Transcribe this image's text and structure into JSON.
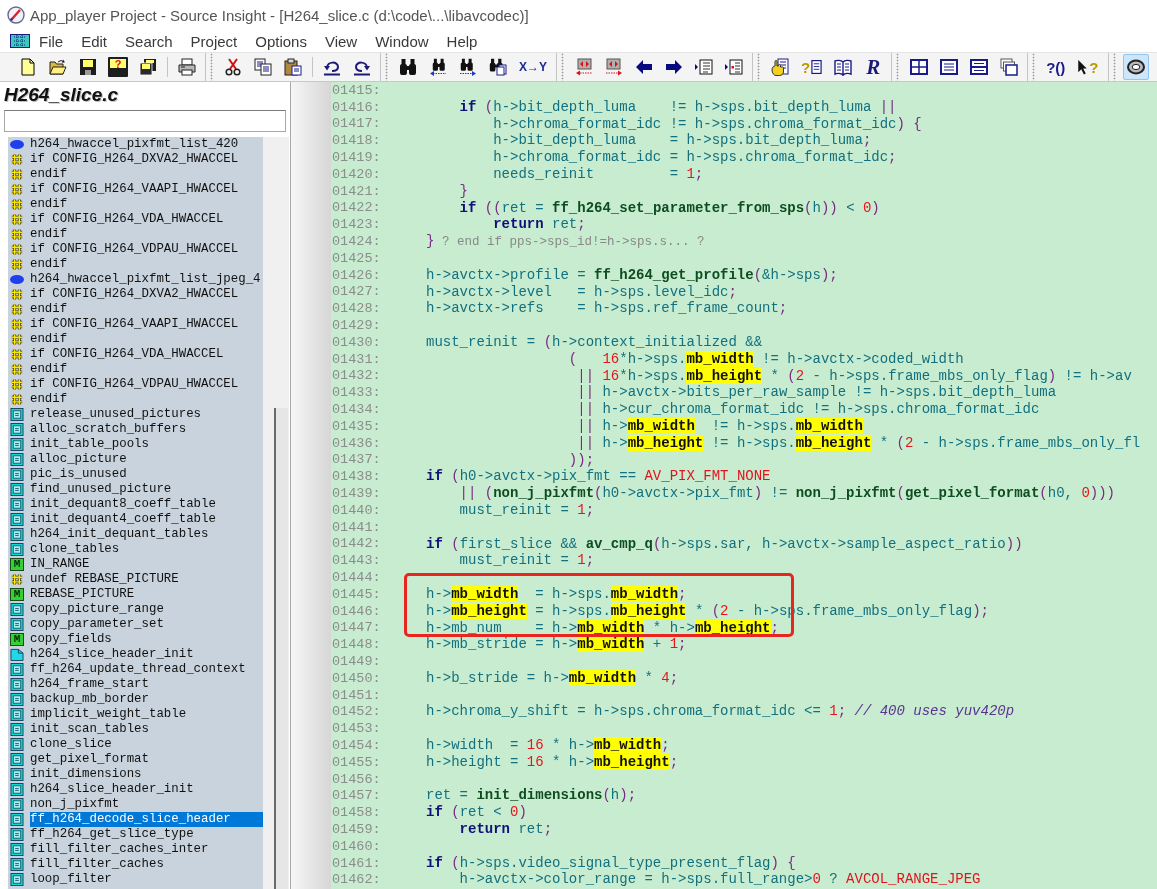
{
  "window": {
    "title": "App_player Project - Source Insight - [H264_slice.c (d:\\code\\...\\libavcodec)]"
  },
  "menu": {
    "items": [
      "File",
      "Edit",
      "Search",
      "Project",
      "Options",
      "View",
      "Window",
      "Help"
    ]
  },
  "toolbar": {
    "bands": [
      {
        "groups": [
          {
            "buttons": [
              {
                "kind": "new",
                "pressed": false
              },
              {
                "kind": "open",
                "pressed": false
              },
              {
                "kind": "save",
                "pressed": false
              },
              {
                "kind": "save_query",
                "label": "?",
                "pressed": false
              },
              {
                "kind": "save_all",
                "pressed": false
              }
            ]
          },
          {
            "buttons": [
              {
                "kind": "print",
                "pressed": false
              }
            ]
          }
        ]
      },
      {
        "groups": [
          {
            "buttons": [
              {
                "kind": "cut",
                "pressed": false
              },
              {
                "kind": "copy",
                "pressed": false
              },
              {
                "kind": "paste",
                "pressed": false
              }
            ]
          },
          {
            "buttons": [
              {
                "kind": "undo",
                "pressed": false
              },
              {
                "kind": "redo",
                "pressed": false
              }
            ]
          }
        ]
      },
      {
        "groups": [
          {
            "buttons": [
              {
                "kind": "find",
                "pressed": false
              },
              {
                "kind": "find_back",
                "pressed": false
              },
              {
                "kind": "find_forward",
                "pressed": false
              },
              {
                "kind": "find_files",
                "pressed": false
              },
              {
                "kind": "replace",
                "label": "X→Y",
                "pressed": false
              }
            ]
          }
        ]
      },
      {
        "groups": [
          {
            "buttons": [
              {
                "kind": "jump_back",
                "pressed": false
              },
              {
                "kind": "jump_forward",
                "pressed": false
              },
              {
                "kind": "back",
                "pressed": false
              },
              {
                "kind": "forward",
                "pressed": false
              },
              {
                "kind": "outline",
                "pressed": false
              },
              {
                "kind": "outline_mark",
                "pressed": false
              }
            ]
          }
        ]
      },
      {
        "groups": [
          {
            "buttons": [
              {
                "kind": "lookup",
                "pressed": false
              },
              {
                "kind": "help_doc",
                "label": "?",
                "pressed": false
              },
              {
                "kind": "book",
                "pressed": false
              },
              {
                "kind": "r_logo",
                "label": "R",
                "pressed": false
              }
            ]
          }
        ]
      },
      {
        "groups": [
          {
            "buttons": [
              {
                "kind": "layout_grid",
                "pressed": false
              },
              {
                "kind": "layout_rows",
                "pressed": false
              },
              {
                "kind": "layout_split",
                "pressed": false
              },
              {
                "kind": "layout_cascade",
                "pressed": false
              }
            ]
          }
        ]
      },
      {
        "groups": [
          {
            "buttons": [
              {
                "kind": "help_paren",
                "label": "?()",
                "pressed": false
              },
              {
                "kind": "help_pointer",
                "label": "?",
                "pressed": false
              }
            ]
          }
        ]
      },
      {
        "groups": [
          {
            "buttons": [
              {
                "kind": "lens",
                "pressed": true
              }
            ]
          }
        ]
      }
    ]
  },
  "sidebar": {
    "title": "H264_slice.c",
    "items": [
      {
        "label": "h264_hwaccel_pixfmt_list_420",
        "kind": "variable",
        "selected": false
      },
      {
        "label": "if CONFIG_H264_DXVA2_HWACCEL",
        "kind": "conditional",
        "selected": false
      },
      {
        "label": "endif",
        "kind": "conditional",
        "selected": false
      },
      {
        "label": "if CONFIG_H264_VAAPI_HWACCEL",
        "kind": "conditional",
        "selected": false
      },
      {
        "label": "endif",
        "kind": "conditional",
        "selected": false
      },
      {
        "label": "if CONFIG_H264_VDA_HWACCEL",
        "kind": "conditional",
        "selected": false
      },
      {
        "label": "endif",
        "kind": "conditional",
        "selected": false
      },
      {
        "label": "if CONFIG_H264_VDPAU_HWACCEL",
        "kind": "conditional",
        "selected": false
      },
      {
        "label": "endif",
        "kind": "conditional",
        "selected": false
      },
      {
        "label": "h264_hwaccel_pixfmt_list_jpeg_4",
        "kind": "variable",
        "selected": false
      },
      {
        "label": "if CONFIG_H264_DXVA2_HWACCEL",
        "kind": "conditional",
        "selected": false
      },
      {
        "label": "endif",
        "kind": "conditional",
        "selected": false
      },
      {
        "label": "if CONFIG_H264_VAAPI_HWACCEL",
        "kind": "conditional",
        "selected": false
      },
      {
        "label": "endif",
        "kind": "conditional",
        "selected": false
      },
      {
        "label": "if CONFIG_H264_VDA_HWACCEL",
        "kind": "conditional",
        "selected": false
      },
      {
        "label": "endif",
        "kind": "conditional",
        "selected": false
      },
      {
        "label": "if CONFIG_H264_VDPAU_HWACCEL",
        "kind": "conditional",
        "selected": false
      },
      {
        "label": "endif",
        "kind": "conditional",
        "selected": false
      },
      {
        "label": "release_unused_pictures",
        "kind": "function",
        "selected": false
      },
      {
        "label": "alloc_scratch_buffers",
        "kind": "function",
        "selected": false
      },
      {
        "label": "init_table_pools",
        "kind": "function",
        "selected": false
      },
      {
        "label": "alloc_picture",
        "kind": "function",
        "selected": false
      },
      {
        "label": "pic_is_unused",
        "kind": "function",
        "selected": false
      },
      {
        "label": "find_unused_picture",
        "kind": "function",
        "selected": false
      },
      {
        "label": "init_dequant8_coeff_table",
        "kind": "function",
        "selected": false
      },
      {
        "label": "init_dequant4_coeff_table",
        "kind": "function",
        "selected": false
      },
      {
        "label": "h264_init_dequant_tables",
        "kind": "function",
        "selected": false
      },
      {
        "label": "clone_tables",
        "kind": "function",
        "selected": false
      },
      {
        "label": "IN_RANGE",
        "kind": "macro",
        "badge": "M",
        "selected": false
      },
      {
        "label": "undef REBASE_PICTURE",
        "kind": "conditional",
        "selected": false
      },
      {
        "label": "REBASE_PICTURE",
        "kind": "macro",
        "badge": "M",
        "selected": false
      },
      {
        "label": "copy_picture_range",
        "kind": "function",
        "selected": false
      },
      {
        "label": "copy_parameter_set",
        "kind": "function",
        "selected": false
      },
      {
        "label": "copy_fields",
        "kind": "macro",
        "badge": "M",
        "selected": false
      },
      {
        "label": "h264_slice_header_init",
        "kind": "prototype",
        "selected": false
      },
      {
        "label": "ff_h264_update_thread_context",
        "kind": "function",
        "selected": false
      },
      {
        "label": "h264_frame_start",
        "kind": "function",
        "selected": false
      },
      {
        "label": "backup_mb_border",
        "kind": "function",
        "selected": false
      },
      {
        "label": "implicit_weight_table",
        "kind": "function",
        "selected": false
      },
      {
        "label": "init_scan_tables",
        "kind": "function",
        "selected": false
      },
      {
        "label": "clone_slice",
        "kind": "function",
        "selected": false
      },
      {
        "label": "get_pixel_format",
        "kind": "function",
        "selected": false
      },
      {
        "label": "init_dimensions",
        "kind": "function",
        "selected": false
      },
      {
        "label": "h264_slice_header_init",
        "kind": "function",
        "selected": false
      },
      {
        "label": "non_j_pixfmt",
        "kind": "function",
        "selected": false
      },
      {
        "label": "ff_h264_decode_slice_header",
        "kind": "function",
        "selected": true
      },
      {
        "label": "ff_h264_get_slice_type",
        "kind": "function",
        "selected": false
      },
      {
        "label": "fill_filter_caches_inter",
        "kind": "function",
        "selected": false
      },
      {
        "label": "fill_filter_caches",
        "kind": "function",
        "selected": false
      },
      {
        "label": "loop_filter",
        "kind": "function",
        "selected": false
      }
    ]
  },
  "code": {
    "lines": [
      {
        "number": "01415:",
        "boxed": false
      },
      {
        "number": "01416:",
        "boxed": false,
        "tokens": [
          {
            "text": "        if",
            "kind": "keyword"
          },
          {
            "text": " (",
            "kind": "punct"
          },
          {
            "text": "h->bit_depth_luma    != h->sps.bit_depth_luma ",
            "kind": "ident"
          },
          {
            "text": "||",
            "kind": "punct"
          }
        ]
      },
      {
        "number": "01417:",
        "boxed": false,
        "tokens": [
          {
            "text": "            h->chroma_format_idc != h->sps.chroma_format_idc",
            "kind": "ident"
          },
          {
            "text": ") {",
            "kind": "punct"
          }
        ]
      },
      {
        "number": "01418:",
        "boxed": false,
        "tokens": [
          {
            "text": "            h->bit_depth_luma    = h->sps.bit_depth_luma",
            "kind": "ident"
          },
          {
            "text": ";",
            "kind": "punct"
          }
        ]
      },
      {
        "number": "01419:",
        "boxed": false,
        "tokens": [
          {
            "text": "            h->chroma_format_idc = h->sps.chroma_format_idc",
            "kind": "ident"
          },
          {
            "text": ";",
            "kind": "punct"
          }
        ]
      },
      {
        "number": "01420:",
        "boxed": false,
        "tokens": [
          {
            "text": "            needs_reinit         = ",
            "kind": "ident"
          },
          {
            "text": "1",
            "kind": "number"
          },
          {
            "text": ";",
            "kind": "punct"
          }
        ]
      },
      {
        "number": "01421:",
        "boxed": false,
        "tokens": [
          {
            "text": "        }",
            "kind": "punct"
          }
        ]
      },
      {
        "number": "01422:",
        "boxed": false,
        "tokens": [
          {
            "text": "        if",
            "kind": "keyword"
          },
          {
            "text": " ((",
            "kind": "punct"
          },
          {
            "text": "ret = ",
            "kind": "ident"
          },
          {
            "text": "ff_h264_set_parameter_from_sps",
            "kind": "function"
          },
          {
            "text": "(",
            "kind": "punct"
          },
          {
            "text": "h",
            "kind": "ident"
          },
          {
            "text": "))",
            "kind": "punct"
          },
          {
            "text": " < ",
            "kind": "ident"
          },
          {
            "text": "0",
            "kind": "number"
          },
          {
            "text": ")",
            "kind": "punct"
          }
        ]
      },
      {
        "number": "01423:",
        "boxed": false,
        "tokens": [
          {
            "text": "            return",
            "kind": "keyword"
          },
          {
            "text": " ret",
            "kind": "ident"
          },
          {
            "text": ";",
            "kind": "punct"
          }
        ]
      },
      {
        "number": "01424:",
        "boxed": false,
        "tokens": [
          {
            "text": "    }",
            "kind": "punct"
          },
          {
            "text": " ? end if pps->sps_id!=h->sps.s... ?",
            "kind": "note"
          }
        ]
      },
      {
        "number": "01425:",
        "boxed": false
      },
      {
        "number": "01426:",
        "boxed": false,
        "tokens": [
          {
            "text": "    h->avctx->profile = ",
            "kind": "ident"
          },
          {
            "text": "ff_h264_get_profile",
            "kind": "function"
          },
          {
            "text": "(",
            "kind": "punct"
          },
          {
            "text": "&h->sps",
            "kind": "ident"
          },
          {
            "text": ");",
            "kind": "punct"
          }
        ]
      },
      {
        "number": "01427:",
        "boxed": false,
        "tokens": [
          {
            "text": "    h->avctx->level   = h->sps.level_idc",
            "kind": "ident"
          },
          {
            "text": ";",
            "kind": "punct"
          }
        ]
      },
      {
        "number": "01428:",
        "boxed": false,
        "tokens": [
          {
            "text": "    h->avctx->refs    = h->sps.ref_frame_count",
            "kind": "ident"
          },
          {
            "text": ";",
            "kind": "punct"
          }
        ]
      },
      {
        "number": "01429:",
        "boxed": false
      },
      {
        "number": "01430:",
        "boxed": false,
        "tokens": [
          {
            "text": "    must_reinit = ",
            "kind": "ident"
          },
          {
            "text": "(",
            "kind": "punct"
          },
          {
            "text": "h->context_initialized &&",
            "kind": "ident"
          }
        ]
      },
      {
        "number": "01431:",
        "boxed": false,
        "tokens": [
          {
            "text": "                     (   ",
            "kind": "punct"
          },
          {
            "text": "16",
            "kind": "number"
          },
          {
            "text": "*h->sps.",
            "kind": "ident"
          },
          {
            "text": "mb_width",
            "kind": "highlight"
          },
          {
            "text": " != h->avctx->coded_width",
            "kind": "ident"
          }
        ]
      },
      {
        "number": "01432:",
        "boxed": false,
        "tokens": [
          {
            "text": "                      || ",
            "kind": "punct"
          },
          {
            "text": "16",
            "kind": "number"
          },
          {
            "text": "*h->sps.",
            "kind": "ident"
          },
          {
            "text": "mb_height",
            "kind": "highlight"
          },
          {
            "text": " * ",
            "kind": "ident"
          },
          {
            "text": "(",
            "kind": "punct"
          },
          {
            "text": "2",
            "kind": "number"
          },
          {
            "text": " - h->sps.frame_mbs_only_flag",
            "kind": "ident"
          },
          {
            "text": ")",
            "kind": "punct"
          },
          {
            "text": " != h->av",
            "kind": "ident"
          }
        ]
      },
      {
        "number": "01433:",
        "boxed": false,
        "tokens": [
          {
            "text": "                      ||",
            "kind": "punct"
          },
          {
            "text": " h->avctx->bits_per_raw_sample != h->sps.bit_depth_luma",
            "kind": "ident"
          }
        ]
      },
      {
        "number": "01434:",
        "boxed": false,
        "tokens": [
          {
            "text": "                      ||",
            "kind": "punct"
          },
          {
            "text": " h->cur_chroma_format_idc != h->sps.chroma_format_idc",
            "kind": "ident"
          }
        ]
      },
      {
        "number": "01435:",
        "boxed": false,
        "tokens": [
          {
            "text": "                      ||",
            "kind": "punct"
          },
          {
            "text": " h->",
            "kind": "ident"
          },
          {
            "text": "mb_width",
            "kind": "highlight"
          },
          {
            "text": "  != h->sps.",
            "kind": "ident"
          },
          {
            "text": "mb_width",
            "kind": "highlight"
          }
        ]
      },
      {
        "number": "01436:",
        "boxed": false,
        "tokens": [
          {
            "text": "                      ||",
            "kind": "punct"
          },
          {
            "text": " h->",
            "kind": "ident"
          },
          {
            "text": "mb_height",
            "kind": "highlight"
          },
          {
            "text": " != h->sps.",
            "kind": "ident"
          },
          {
            "text": "mb_height",
            "kind": "highlight"
          },
          {
            "text": " * ",
            "kind": "ident"
          },
          {
            "text": "(",
            "kind": "punct"
          },
          {
            "text": "2",
            "kind": "number"
          },
          {
            "text": " - h->sps.frame_mbs_only_fl",
            "kind": "ident"
          }
        ]
      },
      {
        "number": "01437:",
        "boxed": false,
        "tokens": [
          {
            "text": "                     ));",
            "kind": "punct"
          }
        ]
      },
      {
        "number": "01438:",
        "boxed": false,
        "tokens": [
          {
            "text": "    if",
            "kind": "keyword"
          },
          {
            "text": " (",
            "kind": "punct"
          },
          {
            "text": "h0->avctx->pix_fmt == ",
            "kind": "ident"
          },
          {
            "text": "AV_PIX_FMT_NONE",
            "kind": "constant"
          }
        ]
      },
      {
        "number": "01439:",
        "boxed": false,
        "tokens": [
          {
            "text": "        || (",
            "kind": "punct"
          },
          {
            "text": "non_j_pixfmt",
            "kind": "function"
          },
          {
            "text": "(",
            "kind": "punct"
          },
          {
            "text": "h0->avctx->pix_fmt",
            "kind": "ident"
          },
          {
            "text": ")",
            "kind": "punct"
          },
          {
            "text": " != ",
            "kind": "ident"
          },
          {
            "text": "non_j_pixfmt",
            "kind": "function"
          },
          {
            "text": "(",
            "kind": "punct"
          },
          {
            "text": "get_pixel_format",
            "kind": "function"
          },
          {
            "text": "(",
            "kind": "punct"
          },
          {
            "text": "h0, ",
            "kind": "ident"
          },
          {
            "text": "0",
            "kind": "number"
          },
          {
            "text": ")))",
            "kind": "punct"
          }
        ]
      },
      {
        "number": "01440:",
        "boxed": false,
        "tokens": [
          {
            "text": "        must_reinit = ",
            "kind": "ident"
          },
          {
            "text": "1",
            "kind": "number"
          },
          {
            "text": ";",
            "kind": "punct"
          }
        ]
      },
      {
        "number": "01441:",
        "boxed": false
      },
      {
        "number": "01442:",
        "boxed": false,
        "tokens": [
          {
            "text": "    if",
            "kind": "keyword"
          },
          {
            "text": " (",
            "kind": "punct"
          },
          {
            "text": "first_slice && ",
            "kind": "ident"
          },
          {
            "text": "av_cmp_q",
            "kind": "function"
          },
          {
            "text": "(",
            "kind": "punct"
          },
          {
            "text": "h->sps.sar, h->avctx->sample_aspect_ratio",
            "kind": "ident"
          },
          {
            "text": "))",
            "kind": "punct"
          }
        ]
      },
      {
        "number": "01443:",
        "boxed": false,
        "tokens": [
          {
            "text": "        must_reinit = ",
            "kind": "ident"
          },
          {
            "text": "1",
            "kind": "number"
          },
          {
            "text": ";",
            "kind": "punct"
          }
        ]
      },
      {
        "number": "01444:",
        "boxed": false
      },
      {
        "number": "01445:",
        "boxed": true,
        "tokens": [
          {
            "text": "    h->",
            "kind": "ident"
          },
          {
            "text": "mb_width",
            "kind": "highlight"
          },
          {
            "text": "  = h->sps.",
            "kind": "ident"
          },
          {
            "text": "mb_width",
            "kind": "highlight"
          },
          {
            "text": ";",
            "kind": "punct"
          }
        ]
      },
      {
        "number": "01446:",
        "boxed": true,
        "tokens": [
          {
            "text": "    h->",
            "kind": "ident"
          },
          {
            "text": "mb_height",
            "kind": "highlight"
          },
          {
            "text": " = h->sps.",
            "kind": "ident"
          },
          {
            "text": "mb_height",
            "kind": "highlight"
          },
          {
            "text": " * ",
            "kind": "ident"
          },
          {
            "text": "(",
            "kind": "punct"
          },
          {
            "text": "2",
            "kind": "number"
          },
          {
            "text": " - h->sps.frame_mbs_only_flag",
            "kind": "ident"
          },
          {
            "text": ");",
            "kind": "punct"
          }
        ]
      },
      {
        "number": "01447:",
        "boxed": true,
        "tokens": [
          {
            "text": "    h->mb_num    = h->",
            "kind": "ident"
          },
          {
            "text": "mb_width",
            "kind": "highlight"
          },
          {
            "text": " * h->",
            "kind": "ident"
          },
          {
            "text": "mb_height",
            "kind": "highlight"
          },
          {
            "text": ";",
            "kind": "punct"
          }
        ]
      },
      {
        "number": "01448:",
        "boxed": false,
        "tokens": [
          {
            "text": "    h->mb_stride = h->",
            "kind": "ident"
          },
          {
            "text": "mb_width",
            "kind": "highlight"
          },
          {
            "text": " + ",
            "kind": "ident"
          },
          {
            "text": "1",
            "kind": "number"
          },
          {
            "text": ";",
            "kind": "punct"
          }
        ]
      },
      {
        "number": "01449:",
        "boxed": false
      },
      {
        "number": "01450:",
        "boxed": false,
        "tokens": [
          {
            "text": "    h->b_stride = h->",
            "kind": "ident"
          },
          {
            "text": "mb_width",
            "kind": "highlight"
          },
          {
            "text": " * ",
            "kind": "ident"
          },
          {
            "text": "4",
            "kind": "number"
          },
          {
            "text": ";",
            "kind": "punct"
          }
        ]
      },
      {
        "number": "01451:",
        "boxed": false
      },
      {
        "number": "01452:",
        "boxed": false,
        "tokens": [
          {
            "text": "    h->chroma_y_shift = h->sps.chroma_format_idc <= ",
            "kind": "ident"
          },
          {
            "text": "1",
            "kind": "number"
          },
          {
            "text": ";",
            "kind": "punct"
          },
          {
            "text": " // 400 uses yuv420p",
            "kind": "comment"
          }
        ]
      },
      {
        "number": "01453:",
        "boxed": false
      },
      {
        "number": "01454:",
        "boxed": false,
        "tokens": [
          {
            "text": "    h->width  = ",
            "kind": "ident"
          },
          {
            "text": "16",
            "kind": "number"
          },
          {
            "text": " * h->",
            "kind": "ident"
          },
          {
            "text": "mb_width",
            "kind": "highlight"
          },
          {
            "text": ";",
            "kind": "punct"
          }
        ]
      },
      {
        "number": "01455:",
        "boxed": false,
        "tokens": [
          {
            "text": "    h->height = ",
            "kind": "ident"
          },
          {
            "text": "16",
            "kind": "number"
          },
          {
            "text": " * h->",
            "kind": "ident"
          },
          {
            "text": "mb_height",
            "kind": "highlight"
          },
          {
            "text": ";",
            "kind": "punct"
          }
        ]
      },
      {
        "number": "01456:",
        "boxed": false
      },
      {
        "number": "01457:",
        "boxed": false,
        "tokens": [
          {
            "text": "    ret = ",
            "kind": "ident"
          },
          {
            "text": "init_dimensions",
            "kind": "function"
          },
          {
            "text": "(",
            "kind": "punct"
          },
          {
            "text": "h",
            "kind": "ident"
          },
          {
            "text": ");",
            "kind": "punct"
          }
        ]
      },
      {
        "number": "01458:",
        "boxed": false,
        "tokens": [
          {
            "text": "    if",
            "kind": "keyword"
          },
          {
            "text": " (",
            "kind": "punct"
          },
          {
            "text": "ret < ",
            "kind": "ident"
          },
          {
            "text": "0",
            "kind": "number"
          },
          {
            "text": ")",
            "kind": "punct"
          }
        ]
      },
      {
        "number": "01459:",
        "boxed": false,
        "tokens": [
          {
            "text": "        return",
            "kind": "keyword"
          },
          {
            "text": " ret",
            "kind": "ident"
          },
          {
            "text": ";",
            "kind": "punct"
          }
        ]
      },
      {
        "number": "01460:",
        "boxed": false
      },
      {
        "number": "01461:",
        "boxed": false,
        "tokens": [
          {
            "text": "    if",
            "kind": "keyword"
          },
          {
            "text": " (",
            "kind": "punct"
          },
          {
            "text": "h->sps.video_signal_type_present_flag",
            "kind": "ident"
          },
          {
            "text": ") {",
            "kind": "punct"
          }
        ]
      },
      {
        "number": "01462:",
        "boxed": false,
        "tokens": [
          {
            "text": "        h->avctx->color_range = h->sps.full_range>",
            "kind": "ident"
          },
          {
            "text": "0",
            "kind": "number"
          },
          {
            "text": " ? ",
            "kind": "ident"
          },
          {
            "text": "AVCOL_RANGE_JPEG",
            "kind": "constant"
          }
        ]
      }
    ]
  }
}
